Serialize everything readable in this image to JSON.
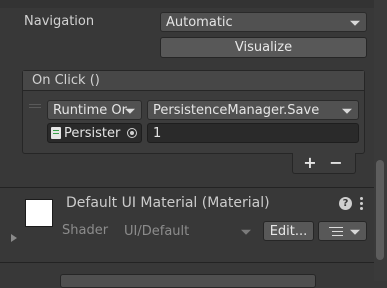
{
  "navigation": {
    "label": "Navigation",
    "value": "Automatic",
    "visualize_label": "Visualize"
  },
  "on_click": {
    "header": "On Click ()",
    "runtime_value": "Runtime Or",
    "function_value": "PersistenceManager.Save",
    "object_value": "Persister",
    "argument_value": "1",
    "add_label": "+",
    "remove_label": "−"
  },
  "material": {
    "title": "Default UI Material (Material)",
    "shader_label": "Shader",
    "shader_value": "UI/Default",
    "edit_label": "Edit...",
    "help_glyph": "?"
  },
  "colors": {
    "background": "#383838",
    "panel": "#3c3c3c",
    "field": "#2a2a2a",
    "button": "#585858",
    "swatch": "#ffffff"
  }
}
